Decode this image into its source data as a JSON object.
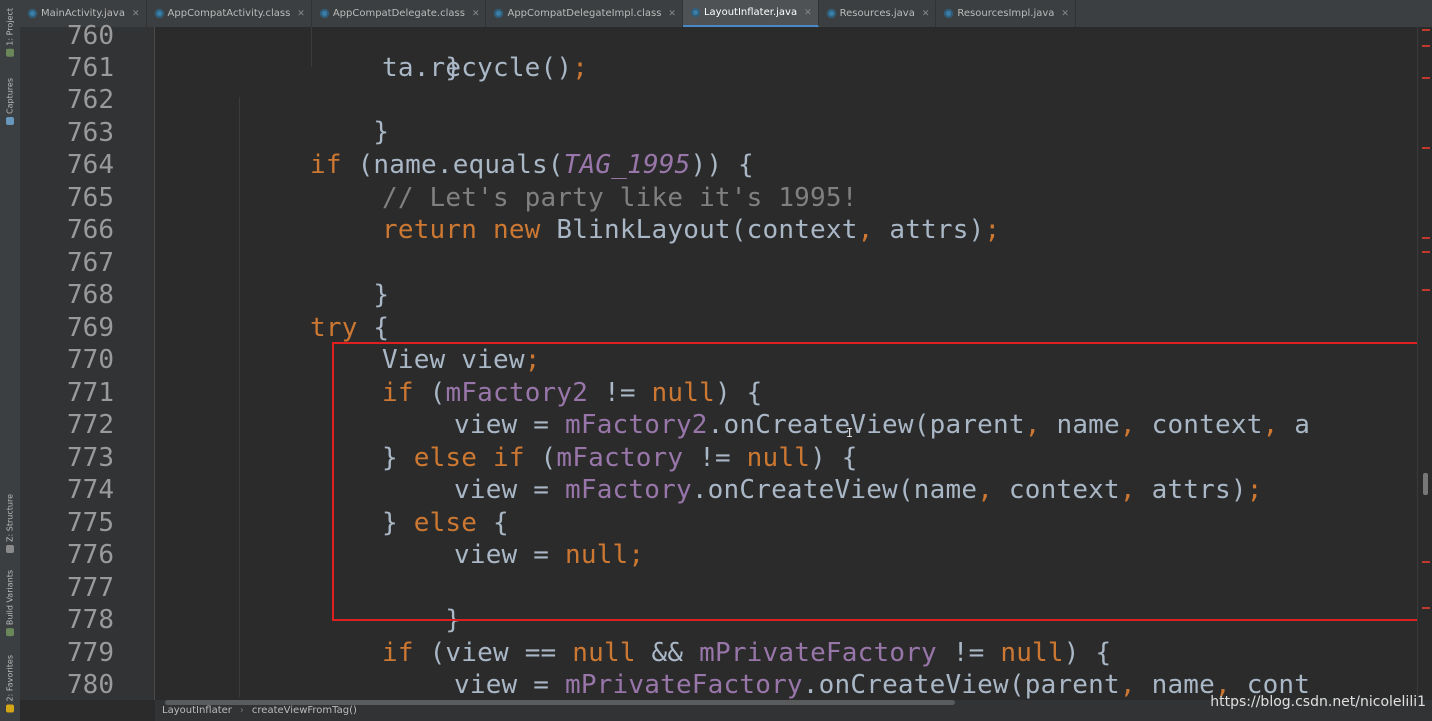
{
  "tool_windows": {
    "project": "1: Project",
    "captures": "Captures",
    "structure": "Z: Structure",
    "build_variants": "Build Variants",
    "favorites": "2: Favorites"
  },
  "tabs": [
    {
      "label": "MainActivity.java",
      "active": false
    },
    {
      "label": "AppCompatActivity.class",
      "active": false
    },
    {
      "label": "AppCompatDelegate.class",
      "active": false
    },
    {
      "label": "AppCompatDelegateImpl.class",
      "active": false
    },
    {
      "label": "LayoutInflater.java",
      "active": true
    },
    {
      "label": "Resources.java",
      "active": false
    },
    {
      "label": "ResourcesImpl.java",
      "active": false
    }
  ],
  "line_numbers": [
    "760",
    "761",
    "762",
    "763",
    "764",
    "765",
    "766",
    "767",
    "768",
    "769",
    "770",
    "771",
    "772",
    "773",
    "774",
    "775",
    "776",
    "777",
    "778",
    "779",
    "780"
  ],
  "code": {
    "l760": "}",
    "l761_a": "ta.recycle()",
    "l761_b": ";",
    "l762": "}",
    "l764_a": "if",
    "l764_b": " (name.equals(",
    "l764_c": "TAG_1995",
    "l764_d": ")) {",
    "l765": "// Let's party like it's 1995!",
    "l766_a": "return new",
    "l766_b": " BlinkLayout(context",
    "l766_c": ",",
    "l766_d": " attrs)",
    "l766_e": ";",
    "l767": "}",
    "l769_a": "try",
    "l769_b": " {",
    "l770_a": "View view",
    "l770_b": ";",
    "l771_a": "if",
    "l771_b": " (",
    "l771_c": "mFactory2",
    "l771_d": " != ",
    "l771_e": "null",
    "l771_f": ") {",
    "l772_a": "view = ",
    "l772_b": "mFactory2",
    "l772_c": ".onCreateView(parent",
    "l772_d": ",",
    "l772_e": " name",
    "l772_f": ",",
    "l772_g": " context",
    "l772_h": ",",
    "l772_i": " a",
    "l773_a": "} ",
    "l773_b": "else if",
    "l773_c": " (",
    "l773_d": "mFactory",
    "l773_e": " != ",
    "l773_f": "null",
    "l773_g": ") {",
    "l774_a": "view = ",
    "l774_b": "mFactory",
    "l774_c": ".onCreateView(name",
    "l774_d": ",",
    "l774_e": " context",
    "l774_f": ",",
    "l774_g": " attrs)",
    "l774_h": ";",
    "l775_a": "} ",
    "l775_b": "else",
    "l775_c": " {",
    "l776_a": "view = ",
    "l776_b": "null",
    "l776_c": ";",
    "l777": "}",
    "l779_a": "if",
    "l779_b": " (view == ",
    "l779_c": "null",
    "l779_d": " && ",
    "l779_e": "mPrivateFactory",
    "l779_f": " != ",
    "l779_g": "null",
    "l779_h": ") {",
    "l780_a": "view = ",
    "l780_b": "mPrivateFactory",
    "l780_c": ".onCreateView(parent",
    "l780_d": ",",
    "l780_e": " name",
    "l780_f": ",",
    "l780_g": " cont"
  },
  "breadcrumb": {
    "class": "LayoutInflater",
    "method": "createViewFromTag()"
  },
  "watermark": "https://blog.csdn.net/nicolelili1",
  "colors": {
    "keyword": "#cc7832",
    "field": "#9876aa",
    "comment": "#808080",
    "text": "#a9b7c6",
    "highlight_box": "#e02020",
    "background": "#2b2b2b"
  }
}
